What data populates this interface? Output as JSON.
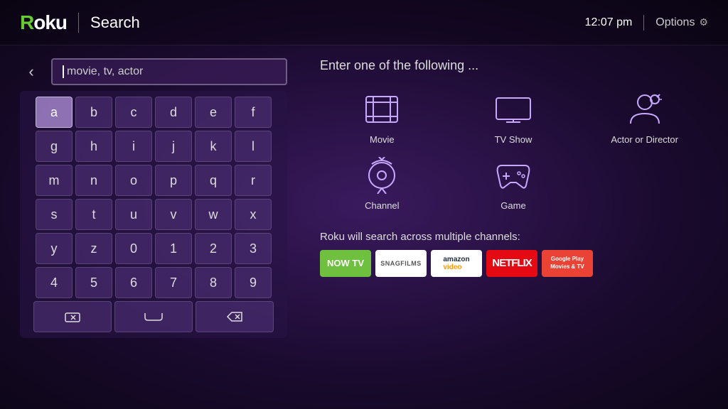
{
  "header": {
    "logo": "Roku",
    "divider": "|",
    "title": "Search",
    "time": "12:07 pm",
    "options_label": "Options"
  },
  "search": {
    "placeholder": "movie, tv, actor"
  },
  "keyboard": {
    "rows": [
      [
        "a",
        "b",
        "c",
        "d",
        "e",
        "f"
      ],
      [
        "g",
        "h",
        "i",
        "j",
        "k",
        "l"
      ],
      [
        "m",
        "n",
        "o",
        "p",
        "q",
        "r"
      ],
      [
        "s",
        "t",
        "u",
        "v",
        "w",
        "x"
      ],
      [
        "y",
        "z",
        "0",
        "1",
        "2",
        "3"
      ],
      [
        "4",
        "5",
        "6",
        "7",
        "8",
        "9"
      ]
    ],
    "action_row": [
      "delete",
      "space",
      "backspace"
    ]
  },
  "right": {
    "enter_text": "Enter one of the following ...",
    "categories": [
      {
        "id": "movie",
        "label": "Movie"
      },
      {
        "id": "tvshow",
        "label": "TV Show"
      },
      {
        "id": "actor",
        "label": "Actor or\nDirector"
      },
      {
        "id": "channel",
        "label": "Channel"
      },
      {
        "id": "game",
        "label": "Game"
      }
    ],
    "channels_text": "Roku will search across multiple channels:",
    "channels": [
      {
        "id": "nowtv",
        "label": "NOW TV"
      },
      {
        "id": "snagfilms",
        "label": "SNAGFILMS"
      },
      {
        "id": "amazon",
        "label": "amazon video"
      },
      {
        "id": "netflix",
        "label": "NETFLIX"
      },
      {
        "id": "google",
        "label": "Google Play\nMovies & TV"
      }
    ]
  }
}
